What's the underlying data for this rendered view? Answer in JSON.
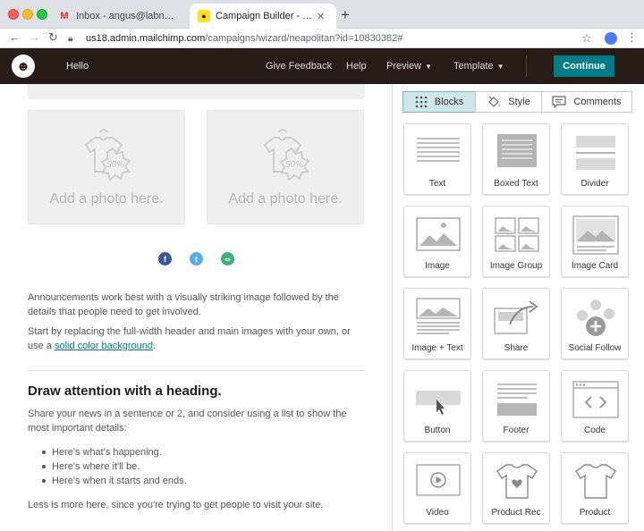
{
  "browser": {
    "tabs": [
      {
        "title": "Inbox - angus@labnol.org - Di",
        "favicon": "gmail-icon"
      },
      {
        "title": "Campaign Builder - Template E",
        "favicon": "mailchimp-icon"
      }
    ],
    "url_host": "us18.admin.mailchimp.com",
    "url_path": "/campaigns/wizard/neapolitan?id=10830382#"
  },
  "header": {
    "hello": "Hello",
    "give_feedback": "Give Feedback",
    "help": "Help",
    "preview": "Preview",
    "template": "Template",
    "continue": "Continue"
  },
  "email": {
    "photo_caption": "Add a photo here.",
    "photo_badge": "50%",
    "para1": "Announcements work best with a visually striking image followed by the details that people need to get involved.",
    "para2_start": "Start by replacing the full-width header and main images with your own, or use a ",
    "para2_link": "solid color background",
    "para2_end": ".",
    "heading": "Draw attention with a heading.",
    "para3": "Share your news in a sentence or 2, and consider using a list to show the most important details:",
    "bullets": [
      "Here's what's happening.",
      "Here's where it'll be.",
      "Here's when it starts and ends."
    ],
    "para4": "Less is more here, since you're trying to get people to visit your site."
  },
  "panel": {
    "tabs": {
      "blocks": "Blocks",
      "style": "Style",
      "comments": "Comments"
    },
    "blocks": [
      {
        "label": "Text",
        "icon": "text-block-icon"
      },
      {
        "label": "Boxed Text",
        "icon": "boxed-text-block-icon"
      },
      {
        "label": "Divider",
        "icon": "divider-block-icon"
      },
      {
        "label": "Image",
        "icon": "image-block-icon"
      },
      {
        "label": "Image Group",
        "icon": "image-group-block-icon"
      },
      {
        "label": "Image Card",
        "icon": "image-card-block-icon"
      },
      {
        "label": "Image + Text",
        "icon": "image-text-block-icon"
      },
      {
        "label": "Share",
        "icon": "share-block-icon"
      },
      {
        "label": "Social Follow",
        "icon": "social-follow-block-icon"
      },
      {
        "label": "Button",
        "icon": "button-block-icon"
      },
      {
        "label": "Footer",
        "icon": "footer-block-icon"
      },
      {
        "label": "Code",
        "icon": "code-block-icon"
      },
      {
        "label": "Video",
        "icon": "video-block-icon"
      },
      {
        "label": "Product Rec",
        "icon": "product-rec-block-icon"
      },
      {
        "label": "Product",
        "icon": "product-block-icon"
      }
    ]
  },
  "colors": {
    "header_bg": "#241c15",
    "accent": "#007c89",
    "selected_tab_bg": "#cfe7ea"
  }
}
